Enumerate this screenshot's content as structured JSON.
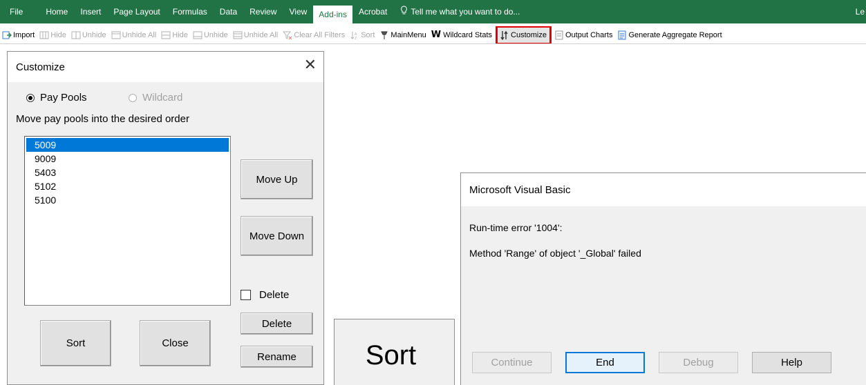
{
  "ribbon": {
    "tabs": [
      "File",
      "Home",
      "Insert",
      "Page Layout",
      "Formulas",
      "Data",
      "Review",
      "View",
      "Add-ins",
      "Acrobat"
    ],
    "active_tab": "Add-ins",
    "tell_me": "Tell me what you want to do...",
    "user": "Le"
  },
  "toolbar": {
    "items": [
      {
        "label": "Import",
        "icon": "import-icon",
        "enabled": true
      },
      {
        "label": "Hide",
        "icon": "hide-columns-icon",
        "enabled": false
      },
      {
        "label": "Unhide",
        "icon": "unhide-columns-icon",
        "enabled": false
      },
      {
        "label": "Unhide All",
        "icon": "unhide-all-columns-icon",
        "enabled": false
      },
      {
        "label": "Hide",
        "icon": "hide-rows-icon",
        "enabled": false
      },
      {
        "label": "Unhide",
        "icon": "unhide-rows-icon",
        "enabled": false
      },
      {
        "label": "Unhide All",
        "icon": "unhide-all-rows-icon",
        "enabled": false
      },
      {
        "label": "Clear All Filters",
        "icon": "clear-filter-icon",
        "enabled": false
      },
      {
        "label": "Sort",
        "icon": "sort-icon",
        "enabled": false
      },
      {
        "label": "MainMenu",
        "icon": "main-menu-icon",
        "enabled": true
      },
      {
        "label": "Wildcard Stats",
        "icon": "wildcard-icon",
        "enabled": true
      },
      {
        "label": "Customize",
        "icon": "customize-icon",
        "enabled": true,
        "highlighted": true
      },
      {
        "label": "Output Charts",
        "icon": "output-charts-icon",
        "enabled": true
      },
      {
        "label": "Generate Aggregate Report",
        "icon": "report-icon",
        "enabled": true
      }
    ],
    "highlight_color": "#e30000"
  },
  "customize_form": {
    "title": "Customize",
    "radio_paypools": "Pay Pools",
    "radio_wildcard": "Wildcard",
    "instruction": "Move pay pools into the desired order",
    "list": [
      "5009",
      "9009",
      "5403",
      "5102",
      "5100"
    ],
    "selected_index": 0,
    "move_up": "Move Up",
    "move_down": "Move Down",
    "delete_checkbox": "Delete",
    "delete_button": "Delete",
    "rename_button": "Rename",
    "sort_button": "Sort",
    "close_button": "Close"
  },
  "sort_preview": {
    "label": "Sort"
  },
  "vb_dialog": {
    "title": "Microsoft Visual Basic",
    "error_line": "Run-time error '1004':",
    "error_message": "Method 'Range' of object '_Global' failed",
    "buttons": {
      "continue": "Continue",
      "end": "End",
      "debug": "Debug",
      "help": "Help"
    }
  },
  "colors": {
    "ribbon_green": "#217346",
    "selection_blue": "#0078d7",
    "dialog_bg": "#f0f0f0"
  }
}
